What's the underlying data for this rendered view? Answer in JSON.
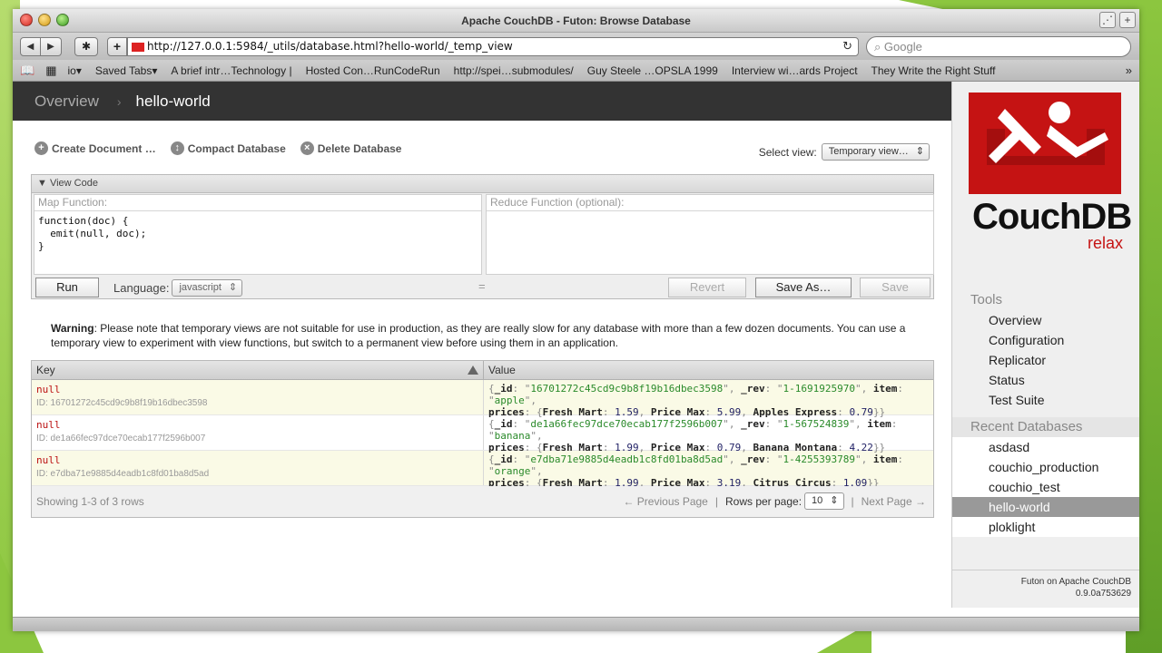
{
  "window": {
    "title": "Apache CouchDB - Futon: Browse Database"
  },
  "toolbar": {
    "url": "http://127.0.0.1:5984/_utils/database.html?hello-world/_temp_view",
    "search_placeholder": "Google"
  },
  "bookmarks": [
    "io▾",
    "Saved Tabs▾",
    "A brief intr…Technology |",
    "Hosted Con…RunCodeRun",
    "http://spei…submodules/",
    "Guy Steele …OPSLA 1999",
    "Interview wi…ards Project",
    "They Write the Right Stuff"
  ],
  "breadcrumb": {
    "root": "Overview",
    "current": "hello-world"
  },
  "actions": {
    "create": "Create Document …",
    "compact": "Compact Database",
    "delete": "Delete Database"
  },
  "select_view": {
    "label": "Select view:",
    "value": "Temporary view…"
  },
  "view_code": {
    "header": "View Code",
    "map_label": "Map Function:",
    "map_code": "function(doc) {\n  emit(null, doc);\n}",
    "reduce_label": "Reduce Function (optional):",
    "run": "Run",
    "language_label": "Language:",
    "language_value": "javascript",
    "revert": "Revert",
    "save_as": "Save As…",
    "save": "Save"
  },
  "warning": {
    "lead": "Warning",
    "text": ": Please note that temporary views are not suitable for use in production, as they are really slow for any database with more than a few dozen documents. You can use a temporary view to experiment with view functions, but switch to a permanent view before using them in an application."
  },
  "results": {
    "key_header": "Key",
    "value_header": "Value",
    "rows": [
      {
        "key": "null",
        "id": "ID: 16701272c45cd9c9b8f19b16dbec3598",
        "_id": "16701272c45cd9c9b8f19b16dbec3598",
        "_rev": "1-1691925970",
        "item": "apple",
        "prices": [
          [
            "Fresh Mart",
            "1.59"
          ],
          [
            "Price Max",
            "5.99"
          ],
          [
            "Apples Express",
            "0.79"
          ]
        ]
      },
      {
        "key": "null",
        "id": "ID: de1a66fec97dce70ecab177f2596b007",
        "_id": "de1a66fec97dce70ecab177f2596b007",
        "_rev": "1-567524839",
        "item": "banana",
        "prices": [
          [
            "Fresh Mart",
            "1.99"
          ],
          [
            "Price Max",
            "0.79"
          ],
          [
            "Banana Montana",
            "4.22"
          ]
        ]
      },
      {
        "key": "null",
        "id": "ID: e7dba71e9885d4eadb1c8fd01ba8d5ad",
        "_id": "e7dba71e9885d4eadb1c8fd01ba8d5ad",
        "_rev": "1-4255393789",
        "item": "orange",
        "prices": [
          [
            "Fresh Mart",
            "1.99"
          ],
          [
            "Price Max",
            "3.19"
          ],
          [
            "Citrus Circus",
            "1.09"
          ]
        ]
      }
    ],
    "showing": "Showing 1-3 of 3 rows",
    "prev": "← Previous Page",
    "rows_per_page_label": "Rows per page:",
    "rows_per_page": "10",
    "next": "Next Page →"
  },
  "sidebar": {
    "logo_text": "CouchDB",
    "logo_sub": "relax",
    "tools_heading": "Tools",
    "tools": [
      "Overview",
      "Configuration",
      "Replicator",
      "Status",
      "Test Suite"
    ],
    "recent_heading": "Recent Databases",
    "recent": [
      "asdasd",
      "couchio_production",
      "couchio_test",
      "hello-world",
      "ploklight"
    ],
    "active_recent": "hello-world",
    "footer_line1": "Futon on Apache CouchDB",
    "footer_line2": "0.9.0a753629"
  },
  "colors": {
    "accent_red": "#c51313",
    "slide_green": "#8cc63f"
  }
}
